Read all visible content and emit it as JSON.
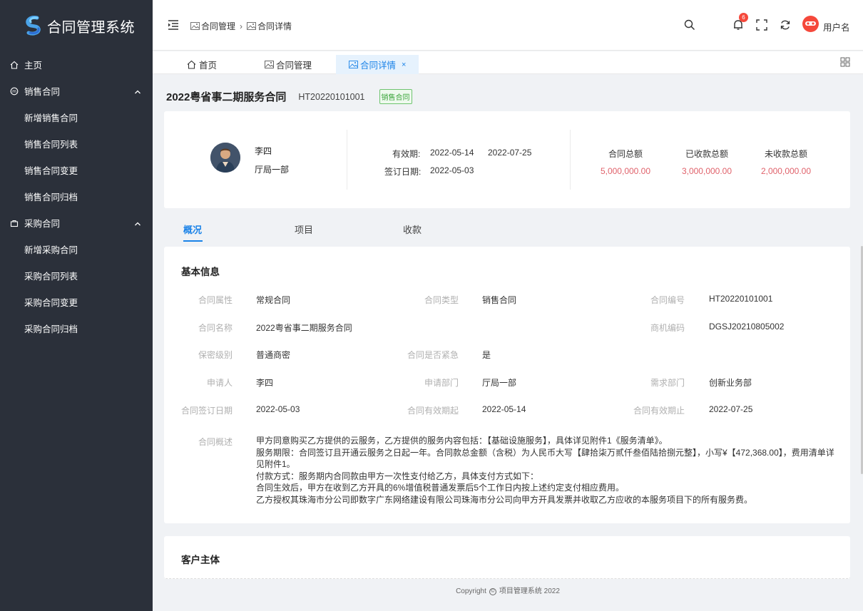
{
  "app": {
    "title": "合同管理系统"
  },
  "sidebar": {
    "items": [
      {
        "label": "主页",
        "icon": "home-icon"
      },
      {
        "label": "销售合同",
        "icon": "sales-icon",
        "expanded": true,
        "children": [
          "新增销售合同",
          "销售合同列表",
          "销售合同变更",
          "销售合同归档"
        ]
      },
      {
        "label": "采购合同",
        "icon": "purchase-icon",
        "expanded": true,
        "children": [
          "新增采购合同",
          "采购合同列表",
          "采购合同变更",
          "采购合同归档"
        ]
      }
    ]
  },
  "topbar": {
    "breadcrumb": [
      "合同管理",
      "合同详情"
    ],
    "notification_count": "6",
    "username": "用户名"
  },
  "tabs": [
    {
      "label": "首页",
      "icon": "home-icon"
    },
    {
      "label": "合同管理",
      "icon": "image-icon"
    },
    {
      "label": "合同详情",
      "icon": "image-icon",
      "active": true,
      "close": "×"
    }
  ],
  "header": {
    "title": "2022粤省事二期服务合同",
    "code": "HT20220101001",
    "badge": "销售合同"
  },
  "summary": {
    "person_name": "李四",
    "person_dept": "厅局一部",
    "validity_label": "有效期:",
    "validity_start": "2022-05-14",
    "validity_end": "2022-07-25",
    "sign_label": "签订日期:",
    "sign_date": "2022-05-03",
    "amounts": [
      {
        "label": "合同总额",
        "value": "5,000,000.00"
      },
      {
        "label": "已收款总额",
        "value": "3,000,000.00"
      },
      {
        "label": "未收款总额",
        "value": "2,000,000.00"
      }
    ]
  },
  "subtabs": [
    {
      "label": "概况",
      "active": true
    },
    {
      "label": "项目"
    },
    {
      "label": "收款"
    }
  ],
  "basic_info": {
    "title": "基本信息",
    "fields": [
      {
        "label": "合同属性",
        "value": "常规合同"
      },
      {
        "label": "合同类型",
        "value": "销售合同"
      },
      {
        "label": "合同编号",
        "value": "HT20220101001"
      },
      {
        "label": "合同名称",
        "value": "2022粤省事二期服务合同"
      },
      {
        "label": "商机编码",
        "value": "DGSJ20210805002"
      },
      {
        "label": "保密级别",
        "value": "普通商密"
      },
      {
        "label": "合同是否紧急",
        "value": "是"
      },
      {
        "label": "申请人",
        "value": "李四"
      },
      {
        "label": "申请部门",
        "value": "厅局一部"
      },
      {
        "label": "需求部门",
        "value": "创新业务部"
      },
      {
        "label": "合同签订日期",
        "value": "2022-05-03"
      },
      {
        "label": "合同有效期起",
        "value": "2022-05-14"
      },
      {
        "label": "合同有效期止",
        "value": "2022-07-25"
      }
    ],
    "overview_label": "合同概述",
    "overview_lines": [
      "甲方同意购买乙方提供的云服务，乙方提供的服务内容包括：【基础设施服务】，具体详见附件1《服务清单》。",
      "服务期限：合同签订且开通云服务之日起一年。合同款总金额（含税）为人民币大写【肆拾柒万贰仟叁佰陆拾捌元整】，小写¥【472,368.00】，费用清单详见附件1。",
      "付款方式：服务期内合同款由甲方一次性支付给乙方，具体支付方式如下：",
      "合同生效后，甲方在收到乙方开具的6%增值税普通发票后5个工作日内按上述约定支付相应费用。",
      "乙方授权其珠海市分公司即数字广东网络建设有限公司珠海市分公司向甲方开具发票并收取乙方应收的本服务项目下的所有服务费。"
    ]
  },
  "client": {
    "title": "客户主体"
  },
  "footer": {
    "copyright": "Copyright",
    "text": "项目管理系统 2022",
    "symbol": "©"
  },
  "colors": {
    "sidebar_bg": "#2b303a",
    "accent": "#1b83e8",
    "amount": "#e0626b",
    "badge_green": "#3aa53a",
    "notice_red": "#f5483b"
  }
}
